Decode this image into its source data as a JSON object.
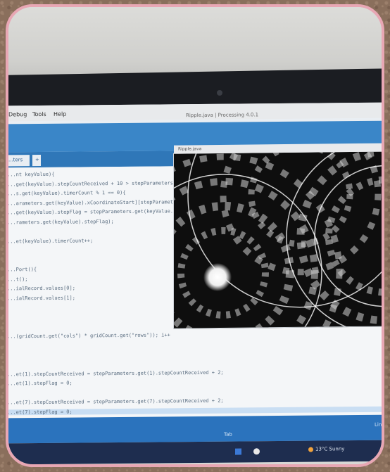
{
  "ide": {
    "menu": [
      "Debug",
      "Tools",
      "Help"
    ],
    "window_title": "Ripple.java | Processing 4.0.1",
    "tabs": [
      "...ters",
      "+"
    ],
    "status_tab": "Tab",
    "status_line": "Line"
  },
  "code_lines": [
    "...nt keyValue){",
    "...get(keyValue).stepCountReceived + 10 > stepParameters...",
    "...s.get(keyValue).timerCount % 1 == 0){",
    "...arameters.get(keyValue).xCoordinateStart][stepParamet...",
    "...get(keyValue).stepFlag = stepParameters.get(keyValue...",
    "...rameters.get(keyValue).stepFlag);",
    "",
    "...et(keyValue).timerCount++;",
    "",
    "",
    "...Port(){",
    "...t();",
    "...ialRecord.values[0];",
    "...ialRecord.values[1];",
    "",
    "",
    "",
    "...(gridCount.get(\"cols\") * gridCount.get(\"rows\")); i++",
    "",
    "",
    "",
    "...et(1).stepCountReceived = stepParameters.get(1).stepCountReceived + 2;",
    "...et(1).stepFlag = 0;",
    "",
    "...et(7).stepCountReceived = stepParameters.get(7).stepCountReceived + 2;",
    "...et(7).stepFlag = 0;"
  ],
  "sketch": {
    "title": "Ripple.java"
  },
  "taskbar": {
    "weather": "13°C Sunny"
  },
  "colors": {
    "ide_blue": "#3a86c8",
    "frame_pink": "#e8a7b4",
    "taskbar": "#1e2d4f"
  }
}
